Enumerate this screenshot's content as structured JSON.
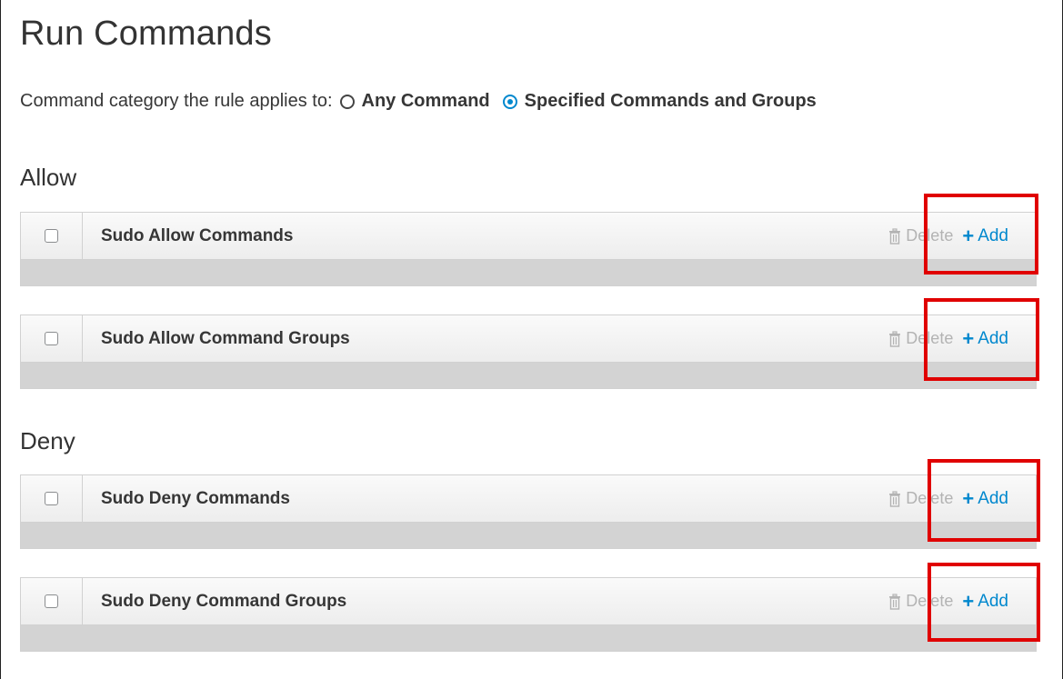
{
  "header": {
    "title": "Run Commands"
  },
  "category": {
    "label": "Command category the rule applies to:",
    "options": [
      {
        "label": "Any Command",
        "selected": false
      },
      {
        "label": "Specified Commands and Groups",
        "selected": true
      }
    ]
  },
  "sections": {
    "allow": {
      "label": "Allow",
      "tables": [
        {
          "title": "Sudo Allow Commands",
          "delete_label": "Delete",
          "add_label": "Add"
        },
        {
          "title": "Sudo Allow Command Groups",
          "delete_label": "Delete",
          "add_label": "Add"
        }
      ]
    },
    "deny": {
      "label": "Deny",
      "tables": [
        {
          "title": "Sudo Deny Commands",
          "delete_label": "Delete",
          "add_label": "Add"
        },
        {
          "title": "Sudo Deny Command Groups",
          "delete_label": "Delete",
          "add_label": "Add"
        }
      ]
    }
  },
  "colors": {
    "accent": "#0088ce",
    "highlight": "#e00000",
    "disabled_text": "#b3b3b3"
  },
  "icons": {
    "delete": "trash-icon",
    "add": "plus-icon",
    "radio_selected": "radio-checked-icon",
    "radio_unselected": "radio-unchecked-icon"
  }
}
